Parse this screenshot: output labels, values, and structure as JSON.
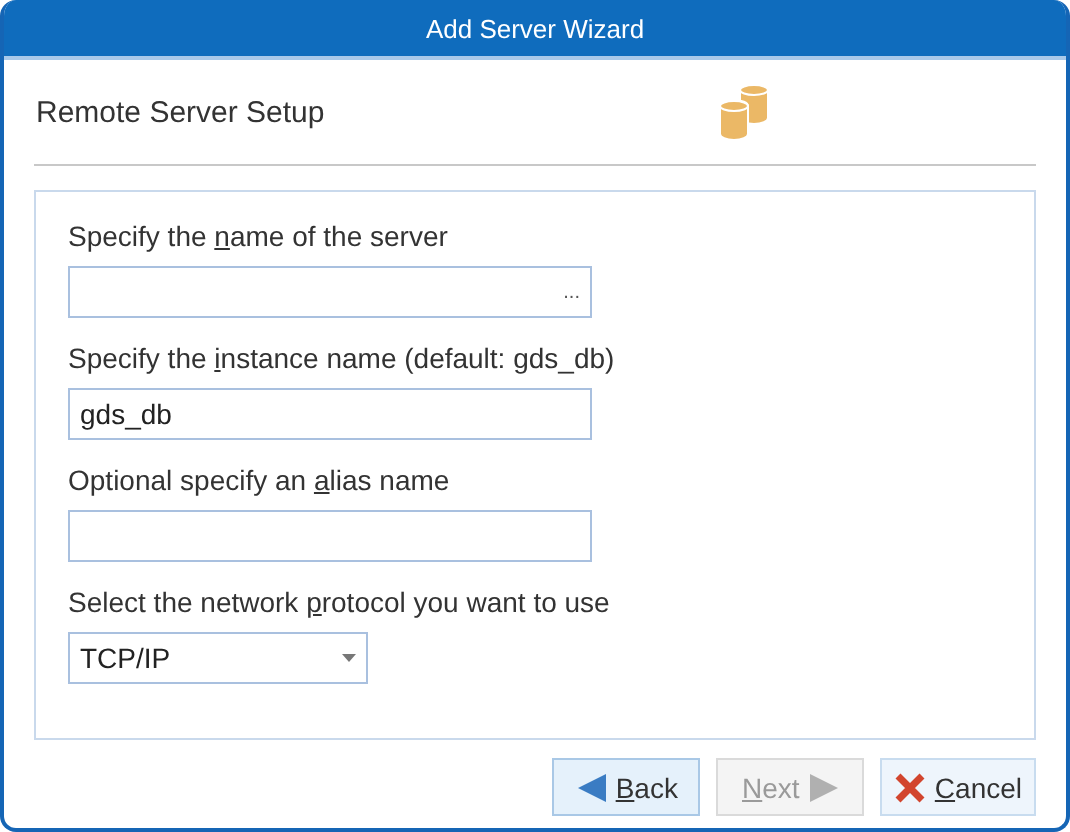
{
  "window": {
    "title": "Add Server Wizard"
  },
  "header": {
    "title": "Remote Server Setup"
  },
  "fields": [
    {
      "kind": "browse",
      "label": {
        "before": "Specify the ",
        "key": "n",
        "after": "ame of the server"
      },
      "browse": "..."
    },
    {
      "kind": "text",
      "label": {
        "before": "Specify the ",
        "key": "i",
        "after": "nstance name (default: gds_db)"
      },
      "value": "gds_db"
    },
    {
      "kind": "text",
      "label": {
        "before": "Optional specify an ",
        "key": "a",
        "after": "lias name"
      }
    },
    {
      "kind": "dropdown",
      "label": {
        "before": "Select the network ",
        "key": "p",
        "after": "rotocol you want to use"
      },
      "value": "TCP/IP"
    }
  ],
  "buttons": [
    {
      "kind": "back",
      "label": {
        "key": "B",
        "after": "ack"
      },
      "disabled": false,
      "selected": true
    },
    {
      "kind": "next",
      "label": {
        "key": "N",
        "after": "ext"
      },
      "disabled": true,
      "selected": false
    },
    {
      "kind": "cancel",
      "label": {
        "key": "C",
        "after": "ancel"
      },
      "disabled": false,
      "selected": false
    }
  ]
}
